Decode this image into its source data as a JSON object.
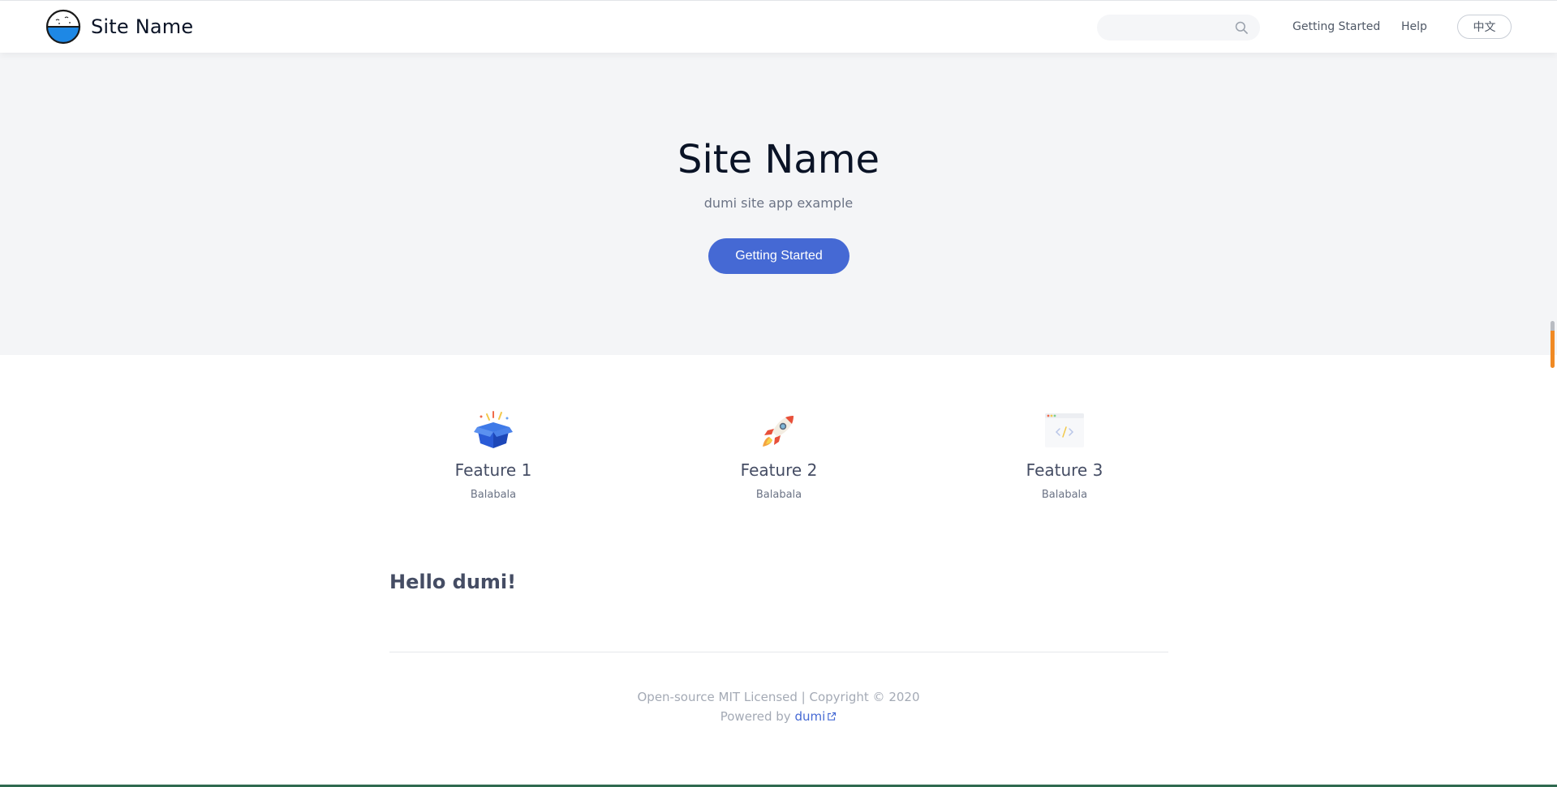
{
  "header": {
    "site_name": "Site Name",
    "search_placeholder": "",
    "nav_items": [
      {
        "label": "Getting Started"
      },
      {
        "label": "Help"
      }
    ],
    "lang_label": "中文"
  },
  "hero": {
    "title": "Site Name",
    "description": "dumi site app example",
    "action_label": "Getting Started"
  },
  "features": [
    {
      "icon": "gift-box-icon",
      "title": "Feature 1",
      "desc": "Balabala"
    },
    {
      "icon": "rocket-icon",
      "title": "Feature 2",
      "desc": "Balabala"
    },
    {
      "icon": "code-window-icon",
      "title": "Feature 3",
      "desc": "Balabala"
    }
  ],
  "content": {
    "heading": "Hello dumi!"
  },
  "footer": {
    "license_text": "Open-source MIT Licensed | Copyright © 2020",
    "powered_prefix": "Powered by ",
    "powered_link": "dumi"
  },
  "colors": {
    "primary": "#4569d4",
    "hero_bg": "#f4f5f7",
    "title_text": "#0a1326",
    "scroll_accent": "#f08a24"
  }
}
